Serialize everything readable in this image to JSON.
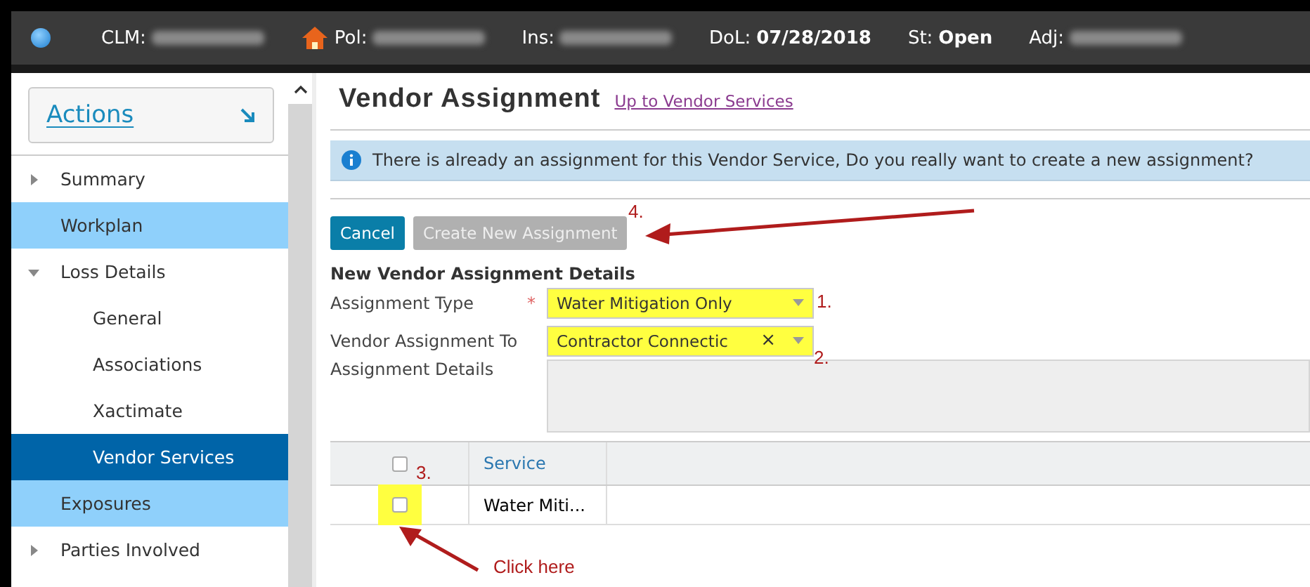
{
  "header": {
    "fields": [
      {
        "label": "CLM:"
      },
      {
        "label": "Pol:"
      },
      {
        "label": "Ins:"
      },
      {
        "label": "DoL:",
        "value": "07/28/2018"
      },
      {
        "label": "St:",
        "value": "Open"
      },
      {
        "label": "Adj:"
      }
    ]
  },
  "sidebar": {
    "actions_label": "Actions",
    "items": [
      {
        "label": "Summary",
        "expanded": false,
        "selected": false,
        "highlighted": false
      },
      {
        "label": "Workplan",
        "selected": false,
        "highlighted": true
      },
      {
        "label": "Loss Details",
        "expanded": true,
        "selected": false,
        "highlighted": false,
        "children": [
          {
            "label": "General",
            "selected": false
          },
          {
            "label": "Associations",
            "selected": false
          },
          {
            "label": "Xactimate",
            "selected": false
          },
          {
            "label": "Vendor Services",
            "selected": true
          }
        ]
      },
      {
        "label": "Exposures",
        "selected": false,
        "highlighted": true
      },
      {
        "label": "Parties Involved",
        "expanded": false,
        "selected": false,
        "highlighted": false
      }
    ]
  },
  "page": {
    "title": "Vendor Assignment",
    "up_link": "Up to Vendor Services",
    "info_message": "There is already an assignment for this Vendor Service, Do you really want to create a new assignment?",
    "buttons": [
      {
        "label": "Cancel",
        "disabled": false
      },
      {
        "label": "Create New Assignment",
        "disabled": true
      }
    ],
    "section_title": "New Vendor Assignment Details",
    "fields": [
      {
        "label": "Assignment Type",
        "kind": "dropdown",
        "required_mark": "*",
        "value": "Water Mitigation Only"
      },
      {
        "label": "Vendor Assignment To",
        "kind": "dropdown",
        "value": "Contractor Connectic",
        "clear_symbol": "×"
      },
      {
        "label": "Assignment Details",
        "kind": "textarea"
      }
    ],
    "table": {
      "columns": [
        "Service"
      ],
      "header_checked": false,
      "rows": [
        {
          "checked": false,
          "service": "Water Miti..."
        }
      ]
    }
  },
  "annotations": [
    {
      "text": "4."
    },
    {
      "text": "1."
    },
    {
      "text": "2."
    },
    {
      "text": "3."
    },
    {
      "text": "Click here"
    }
  ]
}
